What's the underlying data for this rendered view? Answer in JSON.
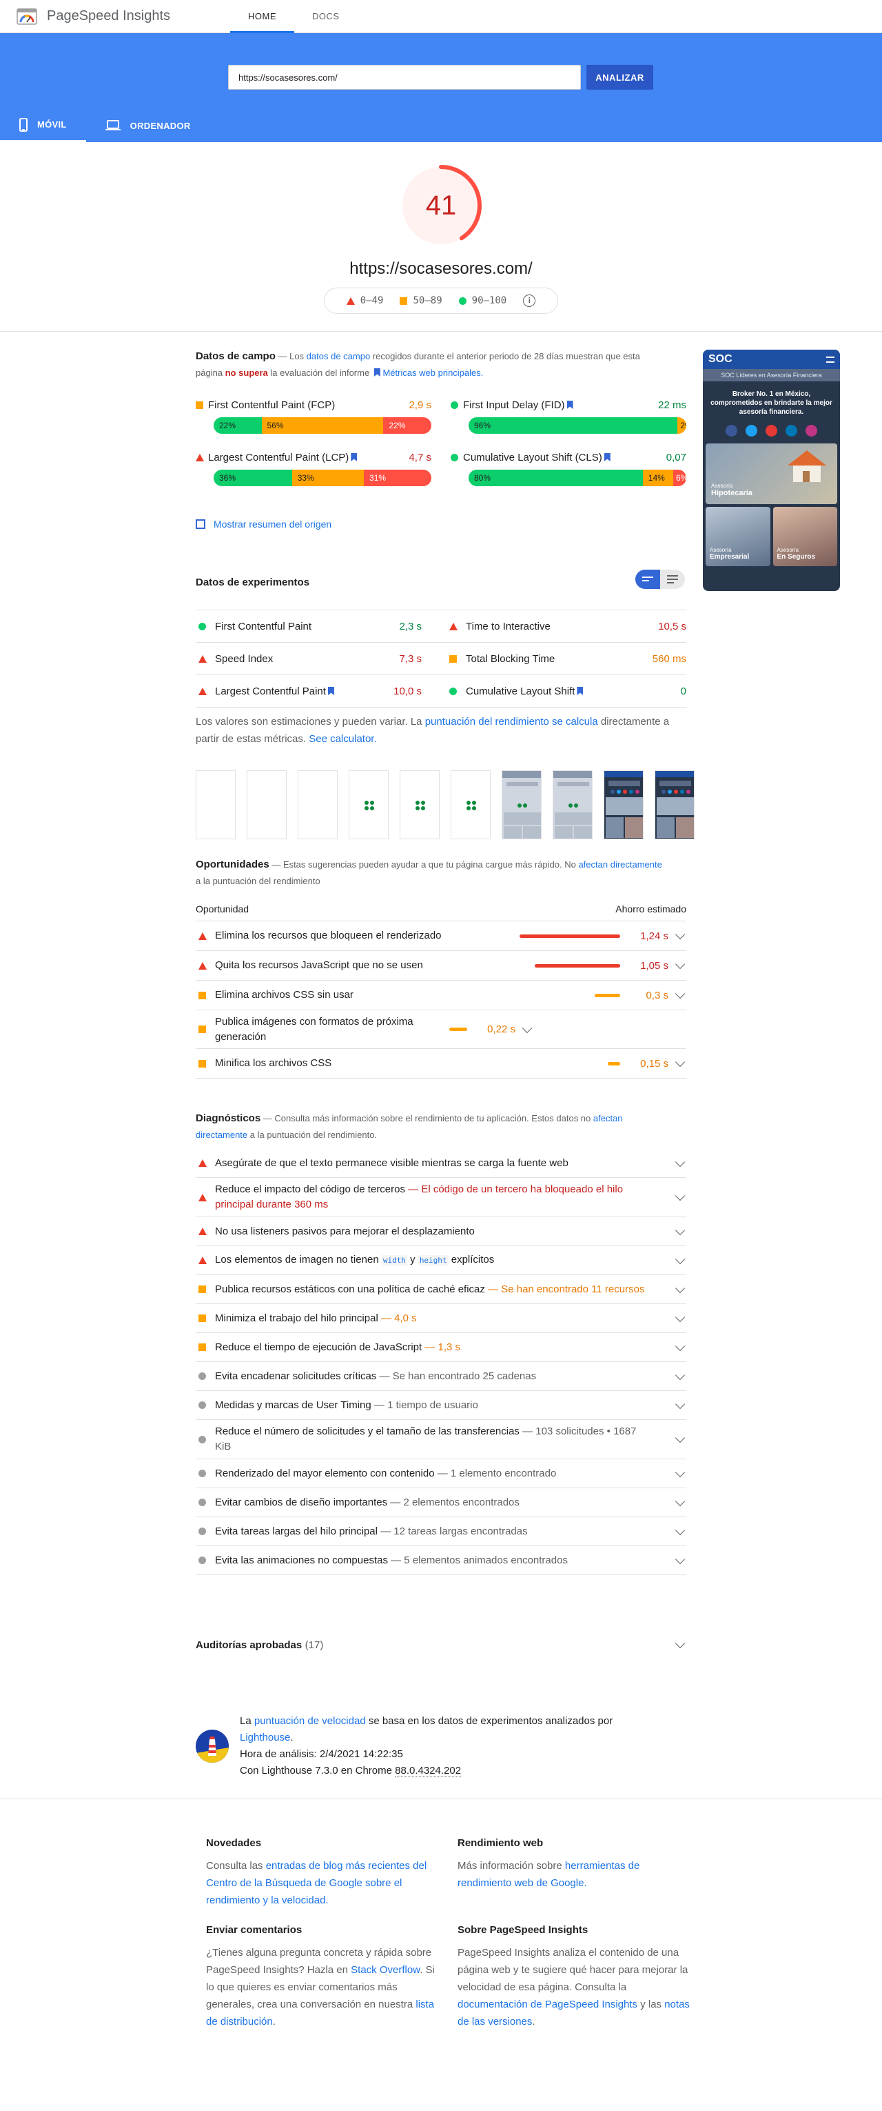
{
  "app": {
    "title": "PageSpeed Insights",
    "tabs": [
      "HOME",
      "DOCS"
    ],
    "active_tab": "HOME"
  },
  "search": {
    "url": "https://socasesores.com/",
    "button": "ANALIZAR"
  },
  "device_tabs": [
    "MÓVIL",
    "ORDENADOR"
  ],
  "score": {
    "value": 41,
    "fraction": 0.41,
    "tested_url": "https://socasesores.com/"
  },
  "legend": [
    "0–49",
    "50–89",
    "90–100"
  ],
  "field": {
    "title": "Datos de campo",
    "desc_1": " — Los ",
    "desc_link": "datos de campo",
    "desc_2": " recogidos durante el anterior periodo de 28 días muestran que esta página ",
    "desc_bold": "no supera",
    "desc_3": " la evaluación del informe ",
    "desc_link2": "Métricas web principales.",
    "metrics": [
      {
        "name": "First Contentful Paint (FCP)",
        "value": "2,9 s",
        "status": "average",
        "bookmark": false,
        "dist": [
          "22%",
          "56%",
          "22%"
        ],
        "share": [
          22,
          56,
          22
        ]
      },
      {
        "name": "First Input Delay (FID)",
        "value": "22 ms",
        "status": "good",
        "bookmark": true,
        "dist": [
          "96%",
          "2%",
          "2%"
        ],
        "share": [
          96,
          2,
          2
        ]
      },
      {
        "name": "Largest Contentful Paint (LCP)",
        "value": "4,7 s",
        "status": "poor",
        "bookmark": true,
        "dist": [
          "36%",
          "33%",
          "31%"
        ],
        "share": [
          36,
          33,
          31
        ]
      },
      {
        "name": "Cumulative Layout Shift (CLS)",
        "value": "0,07",
        "status": "good",
        "bookmark": true,
        "dist": [
          "80%",
          "14%",
          "6%"
        ],
        "share": [
          80,
          14,
          6
        ]
      }
    ],
    "origin_toggle": "Mostrar resumen del origen"
  },
  "lab": {
    "title": "Datos de experimentos",
    "metrics": [
      {
        "name": "First Contentful Paint",
        "value": "2,3 s",
        "status": "good",
        "bookmark": false
      },
      {
        "name": "Time to Interactive",
        "value": "10,5 s",
        "status": "poor",
        "bookmark": false
      },
      {
        "name": "Speed Index",
        "value": "7,3 s",
        "status": "poor",
        "bookmark": false
      },
      {
        "name": "Total Blocking Time",
        "value": "560 ms",
        "status": "average",
        "bookmark": false
      },
      {
        "name": "Largest Contentful Paint",
        "value": "10,0 s",
        "status": "poor",
        "bookmark": true
      },
      {
        "name": "Cumulative Layout Shift",
        "value": "0",
        "status": "good",
        "bookmark": true
      }
    ],
    "note_1": "Los valores son estimaciones y pueden variar. La ",
    "note_link": "puntuación del rendimiento se calcula",
    "note_2": " directamente a partir de estas métricas. ",
    "note_link2": "See calculator."
  },
  "opportunities": {
    "title": "Oportunidades",
    "desc_1": " — Estas sugerencias pueden ayudar a que tu página cargue más rápido. No ",
    "desc_link": "afectan directamente",
    "desc_2": " a la puntuación del rendimiento",
    "col_left": "Oportunidad",
    "col_right": "Ahorro estimado",
    "items": [
      {
        "name": "Elimina los recursos que bloqueen el renderizado",
        "saving": "1,24 s",
        "status": "poor",
        "bar_fraction": 1.0
      },
      {
        "name": "Quita los recursos JavaScript que no se usen",
        "saving": "1,05 s",
        "status": "poor",
        "bar_fraction": 0.85
      },
      {
        "name": "Elimina archivos CSS sin usar",
        "saving": "0,3 s",
        "status": "average",
        "bar_fraction": 0.25
      },
      {
        "name": "Publica imágenes con formatos de próxima generación",
        "saving": "0,22 s",
        "status": "average",
        "bar_fraction": 0.18
      },
      {
        "name": "Minifica los archivos CSS",
        "saving": "0,15 s",
        "status": "average",
        "bar_fraction": 0.12
      }
    ]
  },
  "diagnostics": {
    "title": "Diagnósticos",
    "desc_1": " — Consulta más información sobre el rendimiento de tu aplicación. Estos datos no ",
    "desc_link": "afectan directamente",
    "desc_2": " a la puntuación del rendimiento.",
    "items": [
      {
        "name": "Asegúrate de que el texto permanece visible mientras se carga la fuente web",
        "detail": "",
        "status": "poor"
      },
      {
        "name": "Reduce el impacto del código de terceros",
        "detail": " — El código de un tercero ha bloqueado el hilo principal durante 360 ms",
        "status": "poor"
      },
      {
        "name": "No usa listeners pasivos para mejorar el desplazamiento",
        "detail": "",
        "status": "poor"
      },
      {
        "name_pre": "Los elementos de imagen no tienen ",
        "code1": "width",
        "mid": " y ",
        "code2": "height",
        "name_post": " explícitos",
        "detail": "",
        "status": "poor",
        "code": true
      },
      {
        "name": "Publica recursos estáticos con una política de caché eficaz",
        "detail": " — Se han encontrado 11 recursos",
        "status": "average"
      },
      {
        "name": "Minimiza el trabajo del hilo principal",
        "detail": " — 4,0 s",
        "status": "average"
      },
      {
        "name": "Reduce el tiempo de ejecución de JavaScript",
        "detail": " — 1,3 s",
        "status": "average"
      },
      {
        "name": "Evita encadenar solicitudes críticas",
        "detail": " — Se han encontrado 25 cadenas",
        "status": "info"
      },
      {
        "name": "Medidas y marcas de User Timing",
        "detail": " — 1 tiempo de usuario",
        "status": "info"
      },
      {
        "name": "Reduce el número de solicitudes y el tamaño de las transferencias",
        "detail": " — 103 solicitudes • 1687 KiB",
        "status": "info"
      },
      {
        "name": "Renderizado del mayor elemento con contenido",
        "detail": " — 1 elemento encontrado",
        "status": "info"
      },
      {
        "name": "Evitar cambios de diseño importantes",
        "detail": " — 2 elementos encontrados",
        "status": "info"
      },
      {
        "name": "Evita tareas largas del hilo principal",
        "detail": " — 12 tareas largas encontradas",
        "status": "info"
      },
      {
        "name": "Evita las animaciones no compuestas",
        "detail": " — 5 elementos animados encontrados",
        "status": "info"
      }
    ]
  },
  "passed": {
    "title": "Auditorías aprobadas",
    "count": "(17)"
  },
  "note": {
    "line1_pre": "La ",
    "line1_link": "puntuación de velocidad",
    "line1_post": " se basa en los datos de experimentos analizados por",
    "line2_link": "Lighthouse",
    "line3": "Hora de análisis: 2/4/2021 14:22:35",
    "line4_pre": "Con Lighthouse 7.3.0 en Chrome ",
    "line4_ver": "88.0.4324.202"
  },
  "footer": {
    "news": {
      "title": "Novedades",
      "pre": "Consulta las ",
      "link": "entradas de blog más recientes del Centro de la Búsqueda de Google sobre el rendimiento y la velocidad."
    },
    "perf": {
      "title": "Rendimiento web",
      "pre": "Más información sobre ",
      "link": "herramientas de rendimiento web de Google."
    },
    "feedback": {
      "title": "Enviar comentarios",
      "pre": "¿Tienes alguna pregunta concreta y rápida sobre PageSpeed Insights? Hazla en ",
      "link1": "Stack Overflow",
      "mid": ". Si lo que quieres es enviar comentarios más generales, crea una conversación en nuestra ",
      "link2": "lista de distribución",
      "post": "."
    },
    "about": {
      "title": "Sobre PageSpeed Insights",
      "pre": "PageSpeed Insights analiza el contenido de una página web y te sugiere qué hacer para mejorar la velocidad de esa página. Consulta la ",
      "link1": "documentación de PageSpeed Insights",
      "mid": " y las ",
      "link2": "notas de las versiones",
      "post": "."
    }
  },
  "phone_preview": {
    "logo": "SOC",
    "tagline": "SOC Líderes en Asesoría Financiera",
    "headline": "Broker No. 1 en México, comprometidos en brindarte la mejor asesoría financiera.",
    "card1_small": "Asesoría",
    "card1": "Hipotecaria",
    "card2_small": "Asesoría",
    "card2": "Empresarial",
    "card3_small": "Asesoría",
    "card3": "En Seguros"
  },
  "colors": {
    "accent": "#4285f4",
    "poor": "#eb3b27",
    "average": "#ffa400",
    "good": "#0cce6b"
  }
}
